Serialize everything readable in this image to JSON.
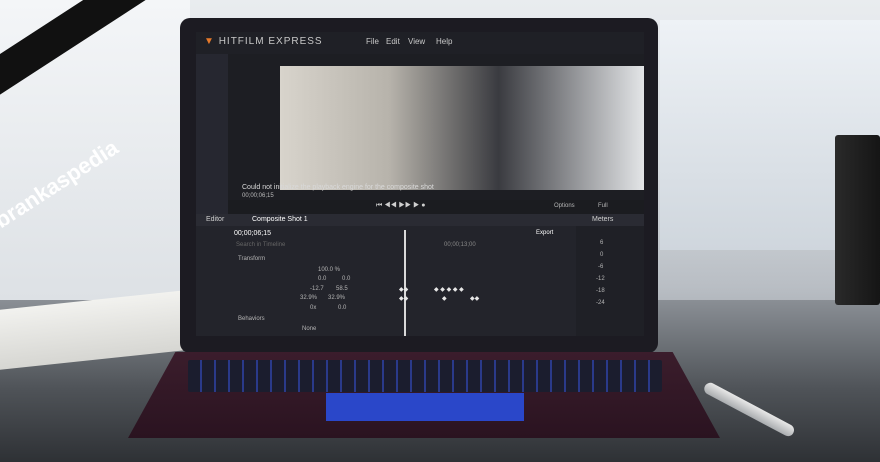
{
  "app": {
    "logo_text": "HITFILM EXPRESS",
    "menu": [
      "File",
      "Edit",
      "View",
      "Help"
    ],
    "viewer_message": "Could not initialize the playback engine for the composite shot",
    "viewer_timecode": "00;00;06;15",
    "viewer_controls": {
      "options": "Options",
      "zoom": "Full"
    },
    "tabs": {
      "editor": "Editor",
      "composite": "Composite Shot 1",
      "meters": "Meters"
    },
    "timeline": {
      "timecode": "00;00;06;15",
      "search_placeholder": "Search in Timeline",
      "export": "Export",
      "ruler_end": "00;00;13;00",
      "group": "Transform",
      "rows": [
        {
          "a": "100.0 %",
          "b": ""
        },
        {
          "a": "0.0",
          "b": "0.0"
        },
        {
          "a": "-12.7",
          "b": "58.5"
        },
        {
          "a": "32.9%",
          "b": "32.9%"
        },
        {
          "a": "0x",
          "b": "0.0"
        }
      ],
      "behaviors": "Behaviors",
      "none_value": "None"
    },
    "meter_labels": [
      "6",
      "0",
      "-6",
      "-12",
      "-18",
      "-24"
    ]
  },
  "watermark": "brankaspedia"
}
